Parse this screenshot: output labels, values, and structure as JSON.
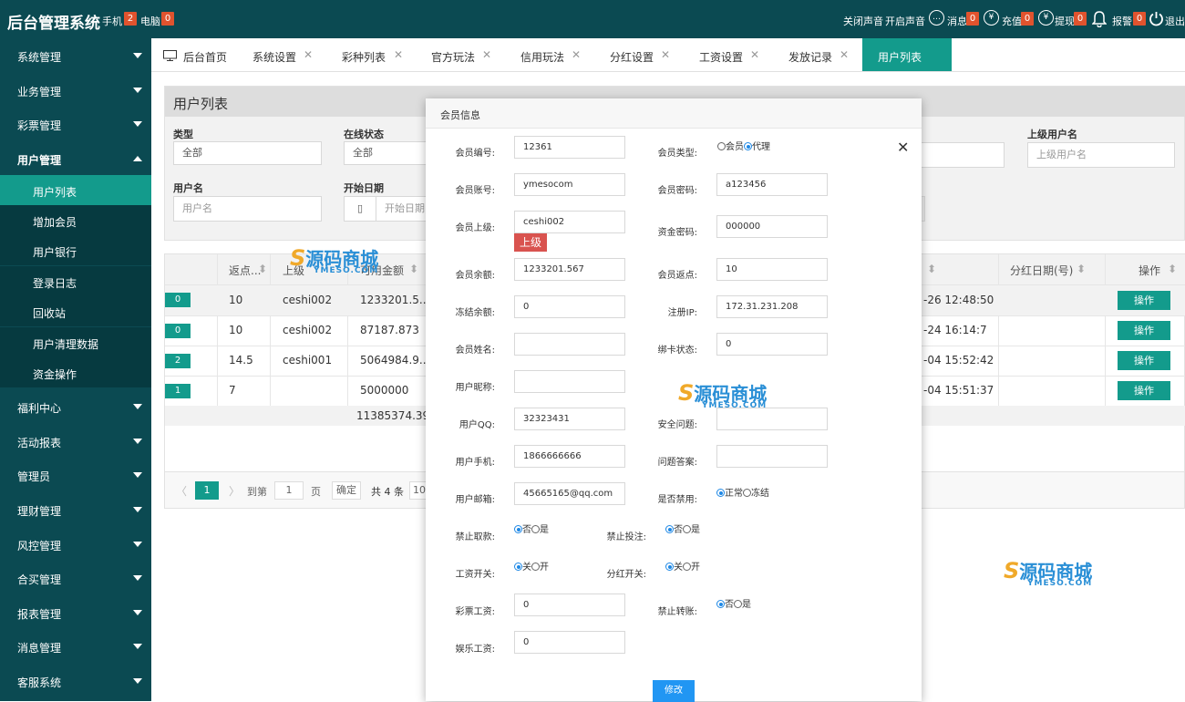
{
  "header": {
    "title": "后台管理系统",
    "mobile_label": "手机",
    "mobile_count": "2",
    "pc_label": "电脑",
    "pc_count": "0",
    "mute_sound": "关闭声音",
    "enable_sound": "开启声音",
    "message_label": "消息",
    "message_count": "0",
    "recharge_label": "充值",
    "recharge_count": "0",
    "withdraw_label": "提现",
    "withdraw_count": "0",
    "alarm_label": "报警",
    "alarm_count": "0",
    "logout_label": "退出"
  },
  "sidebar": {
    "items": [
      {
        "label": "系统管理"
      },
      {
        "label": "业务管理"
      },
      {
        "label": "彩票管理"
      },
      {
        "label": "用户管理"
      },
      {
        "label": "福利中心"
      },
      {
        "label": "活动报表"
      },
      {
        "label": "管理员"
      },
      {
        "label": "理财管理"
      },
      {
        "label": "风控管理"
      },
      {
        "label": "合买管理"
      },
      {
        "label": "报表管理"
      },
      {
        "label": "消息管理"
      },
      {
        "label": "客服系统"
      }
    ],
    "sub_items": [
      {
        "label": "用户列表"
      },
      {
        "label": "增加会员"
      },
      {
        "label": "用户银行"
      },
      {
        "label": "登录日志"
      },
      {
        "label": "回收站"
      },
      {
        "label": "用户清理数据"
      },
      {
        "label": "资金操作"
      }
    ]
  },
  "tabs": [
    {
      "label": "后台首页"
    },
    {
      "label": "系统设置"
    },
    {
      "label": "彩种列表"
    },
    {
      "label": "官方玩法"
    },
    {
      "label": "信用玩法"
    },
    {
      "label": "分红设置"
    },
    {
      "label": "工资设置"
    },
    {
      "label": "发放记录"
    },
    {
      "label": "用户列表"
    }
  ],
  "panel": {
    "title": "用户列表",
    "type_label": "类型",
    "type_value": "全部",
    "online_label": "在线状态",
    "online_value": "全部",
    "parent_label": "上级用户名",
    "parent_placeholder": "上级用户名",
    "username_label": "用户名",
    "username_placeholder": "用户名",
    "start_date_label": "开始日期",
    "start_date_placeholder": "开始日期"
  },
  "table": {
    "headers": {
      "rebate": "返点...",
      "parent": "上级",
      "balance": "可用金额",
      "dividend_date": "分红日期(号)",
      "action": "操作"
    },
    "rows": [
      {
        "type": "0",
        "rebate": "10",
        "parent": "ceshi002",
        "balance": "1233201.5...",
        "time": "-26 12:48:50",
        "action": "操作"
      },
      {
        "type": "0",
        "rebate": "10",
        "parent": "ceshi002",
        "balance": "87187.873",
        "time": "-24 16:14:7",
        "action": "操作"
      },
      {
        "type": "2",
        "rebate": "14.5",
        "parent": "ceshi001",
        "balance": "5064984.9...",
        "time": "-04 15:52:42",
        "action": "操作"
      },
      {
        "type": "1",
        "rebate": "7",
        "parent": "",
        "balance": "5000000",
        "time": "-04 15:51:37",
        "action": "操作"
      }
    ],
    "total_balance": "11385374.397"
  },
  "pager": {
    "current": "1",
    "goto_label": "到第",
    "page_input": "1",
    "page_unit": "页",
    "confirm_label": "确定",
    "total_label": "共 4 条",
    "page_size": "10"
  },
  "watermarks": {
    "brand": "源码商城",
    "domain": "YMESO.COM"
  },
  "modal": {
    "title": "会员信息",
    "fields": {
      "member_id_label": "会员编号:",
      "member_id": "12361",
      "member_type_label": "会员类型:",
      "type_member": "会员",
      "type_agent": "代理",
      "account_label": "会员账号:",
      "account": "ymesocom",
      "password_label": "会员密码:",
      "password": "a123456",
      "parent_label": "会员上级:",
      "parent": "ceshi002",
      "parent_button": "上级",
      "fund_password_label": "资金密码:",
      "fund_password": "000000",
      "balance_label": "会员余额:",
      "balance": "1233201.567",
      "rebate_label": "会员返点:",
      "rebate": "10",
      "frozen_label": "冻结余额:",
      "frozen": "0",
      "reg_ip_label": "注册IP:",
      "reg_ip": "172.31.231.208",
      "real_name_label": "会员姓名:",
      "real_name": "",
      "bind_card_label": "绑卡状态:",
      "bind_card": "0",
      "nickname_label": "用户昵称:",
      "nickname": "",
      "qq_label": "用户QQ:",
      "qq": "32323431",
      "security_q_label": "安全问题:",
      "security_q": "",
      "phone_label": "用户手机:",
      "phone": "1866666666",
      "answer_label": "问题答案:",
      "answer": "",
      "email_label": "用户邮箱:",
      "email": "45665165@qq.com",
      "banned_label": "是否禁用:",
      "banned_normal": "正常",
      "banned_frozen": "冻结",
      "no_withdraw_label": "禁止取款:",
      "no_bet_label": "禁止投注:",
      "salary_switch_label": "工资开关:",
      "dividend_switch_label": "分红开关:",
      "no": "否",
      "yes": "是",
      "off": "关",
      "on": "开",
      "lottery_salary_label": "彩票工资:",
      "lottery_salary": "0",
      "no_transfer_label": "禁止转账:",
      "ent_salary_label": "娱乐工资:",
      "ent_salary": "0"
    },
    "save_button": "修改",
    "close_icon": "close-icon"
  }
}
